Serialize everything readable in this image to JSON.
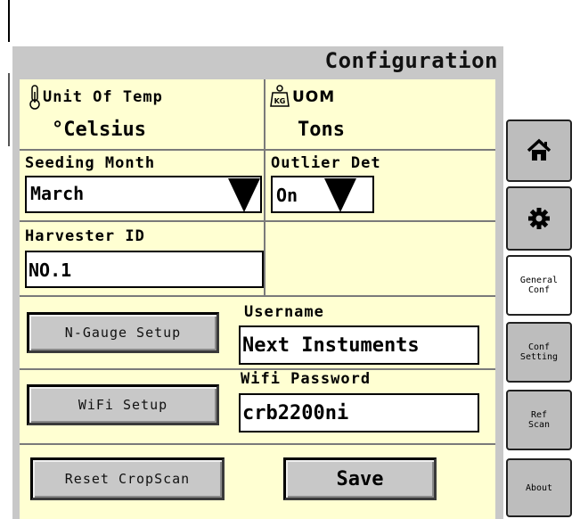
{
  "header": {
    "title": "Configuration"
  },
  "unit_of_temp": {
    "label": "Unit Of Temp",
    "value": "°Celsius",
    "icon": "thermometer-icon"
  },
  "uom": {
    "label": "UOM",
    "value": "Tons",
    "icon": "kg-weight-icon"
  },
  "seeding_month": {
    "label": "Seeding Month",
    "value": "March"
  },
  "outlier_det": {
    "label": "Outlier Det",
    "value": "On"
  },
  "harvester_id": {
    "label": "Harvester ID",
    "value": "NO.1"
  },
  "username": {
    "label": "Username",
    "value": "Next Instuments"
  },
  "wifi_password": {
    "label": "Wifi Password",
    "value": "crb2200ni"
  },
  "buttons": {
    "n_gauge_setup": "N-Gauge Setup",
    "wifi_setup": "WiFi Setup",
    "reset_cropscan": "Reset CropScan",
    "save": "Save"
  },
  "tabs": [
    {
      "name": "home",
      "icon": "home-icon",
      "label": ""
    },
    {
      "name": "settings",
      "icon": "gear-icon",
      "label": ""
    },
    {
      "name": "general-conf",
      "label": "General\nConf",
      "active": true
    },
    {
      "name": "conf-setting",
      "label": "Conf\nSetting"
    },
    {
      "name": "ref-scan",
      "label": "Ref\nScan"
    },
    {
      "name": "about",
      "label": "About"
    }
  ],
  "colors": {
    "panel": "#c8c8c8",
    "content": "#ffffd2",
    "active_tab": "#ffffff"
  }
}
